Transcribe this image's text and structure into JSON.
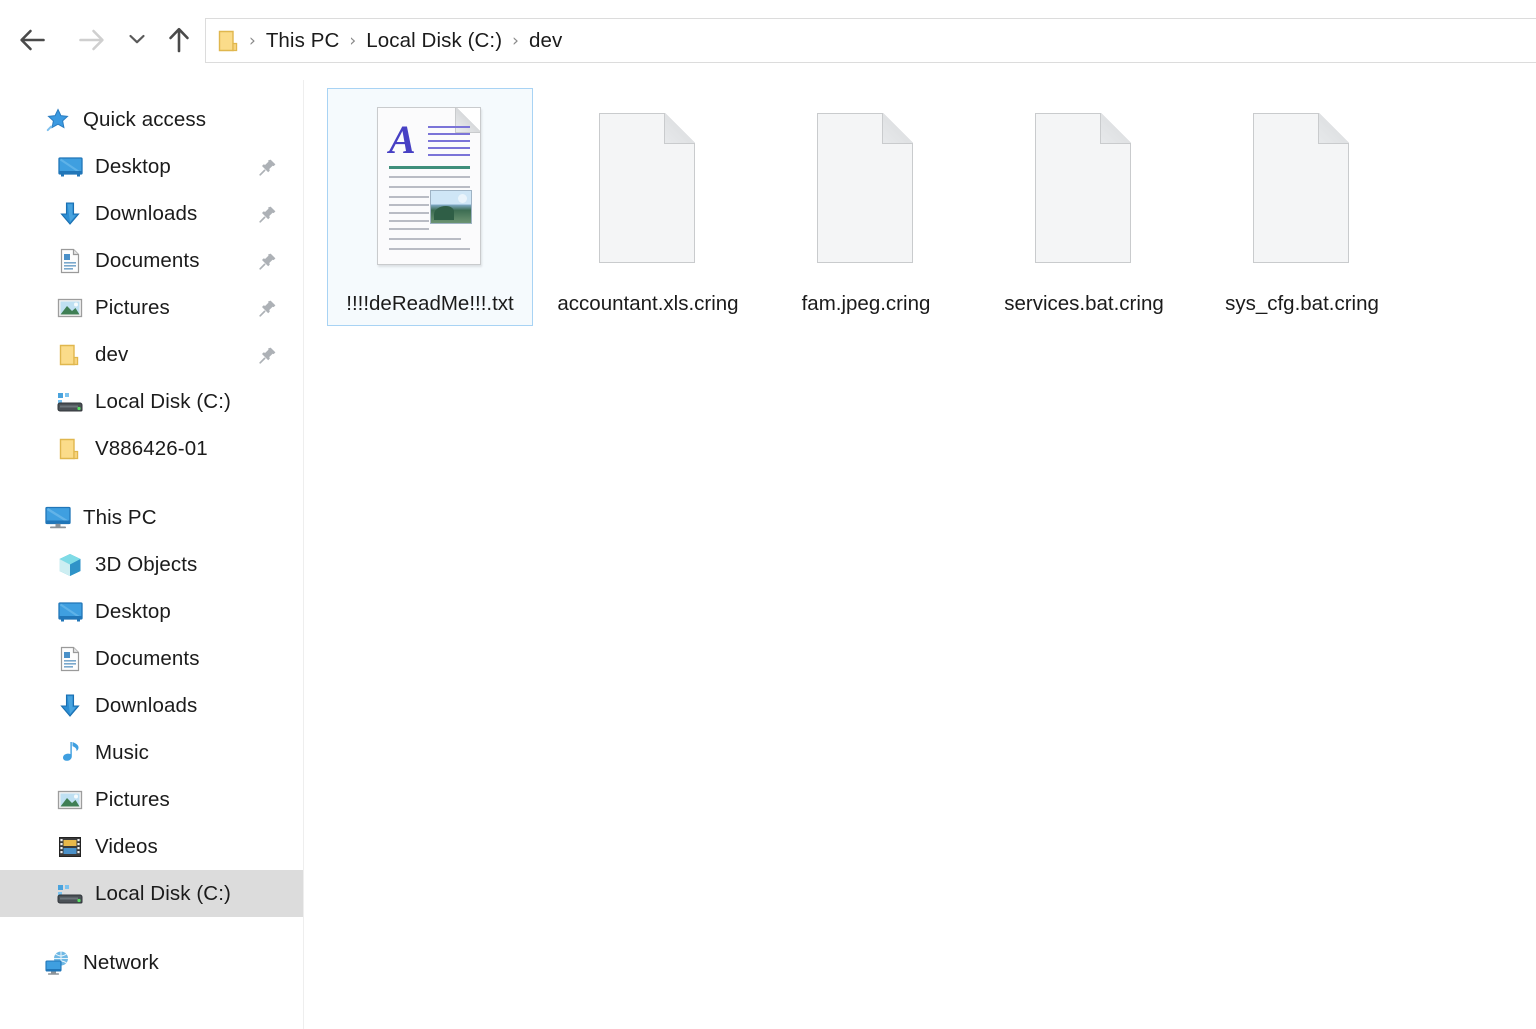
{
  "window": {
    "title": "dev",
    "app": "File Explorer"
  },
  "nav": {
    "back_label": "Back",
    "back_icon": "arrow-left-icon",
    "back_enabled": true,
    "forward_label": "Forward",
    "forward_icon": "arrow-right-icon",
    "forward_enabled": false,
    "recent_label": "Recent locations",
    "recent_icon": "chevron-down-icon",
    "up_label": "Up to Local Disk (C:)",
    "up_icon": "arrow-up-icon",
    "address_icon": "folder-icon",
    "breadcrumbs": [
      {
        "label": "This PC"
      },
      {
        "label": "Local Disk (C:)"
      },
      {
        "label": "dev"
      }
    ],
    "separator": "›"
  },
  "sidebar": {
    "groups": [
      {
        "header": {
          "label": "Quick access",
          "icon": "star-pin-icon"
        },
        "items": [
          {
            "label": "Desktop",
            "icon": "monitor-icon",
            "pinned": true,
            "selected": false
          },
          {
            "label": "Downloads",
            "icon": "download-arrow-icon",
            "pinned": true,
            "selected": false
          },
          {
            "label": "Documents",
            "icon": "document-icon",
            "pinned": true,
            "selected": false
          },
          {
            "label": "Pictures",
            "icon": "picture-icon",
            "pinned": true,
            "selected": false
          },
          {
            "label": "dev",
            "icon": "folder-icon",
            "pinned": true,
            "selected": false
          },
          {
            "label": "Local Disk (C:)",
            "icon": "hard-drive-icon",
            "pinned": false,
            "selected": false
          },
          {
            "label": "V886426-01",
            "icon": "folder-icon",
            "pinned": false,
            "selected": false
          }
        ]
      },
      {
        "header": {
          "label": "This PC",
          "icon": "this-pc-icon"
        },
        "items": [
          {
            "label": "3D Objects",
            "icon": "3d-cube-icon",
            "pinned": false,
            "selected": false
          },
          {
            "label": "Desktop",
            "icon": "monitor-icon",
            "pinned": false,
            "selected": false
          },
          {
            "label": "Documents",
            "icon": "document-icon",
            "pinned": false,
            "selected": false
          },
          {
            "label": "Downloads",
            "icon": "download-arrow-icon",
            "pinned": false,
            "selected": false
          },
          {
            "label": "Music",
            "icon": "music-note-icon",
            "pinned": false,
            "selected": false
          },
          {
            "label": "Pictures",
            "icon": "picture-icon",
            "pinned": false,
            "selected": false
          },
          {
            "label": "Videos",
            "icon": "video-filmstrip-icon",
            "pinned": false,
            "selected": false
          },
          {
            "label": "Local Disk (C:)",
            "icon": "hard-drive-icon",
            "pinned": false,
            "selected": true
          }
        ]
      },
      {
        "header": {
          "label": "Network",
          "icon": "network-icon"
        },
        "items": []
      }
    ]
  },
  "files": {
    "items": [
      {
        "name": "!!!!deReadMe!!!.txt",
        "icon": "rich-document-icon",
        "selected": true
      },
      {
        "name": "accountant.xls.cring",
        "icon": "blank-document-icon",
        "selected": false
      },
      {
        "name": "fam.jpeg.cring",
        "icon": "blank-document-icon",
        "selected": false
      },
      {
        "name": "services.bat.cring",
        "icon": "blank-document-icon",
        "selected": false
      },
      {
        "name": "sys_cfg.bat.cring",
        "icon": "blank-document-icon",
        "selected": false
      }
    ]
  },
  "colors": {
    "selection_border": "#a8d3f4",
    "selection_fill": "#f5fafd",
    "sidebar_selected": "#dcdcdc",
    "accent_blue": "#1e8fd5",
    "folder_yellow": "#fbd579",
    "text": "#1b1b1b"
  }
}
